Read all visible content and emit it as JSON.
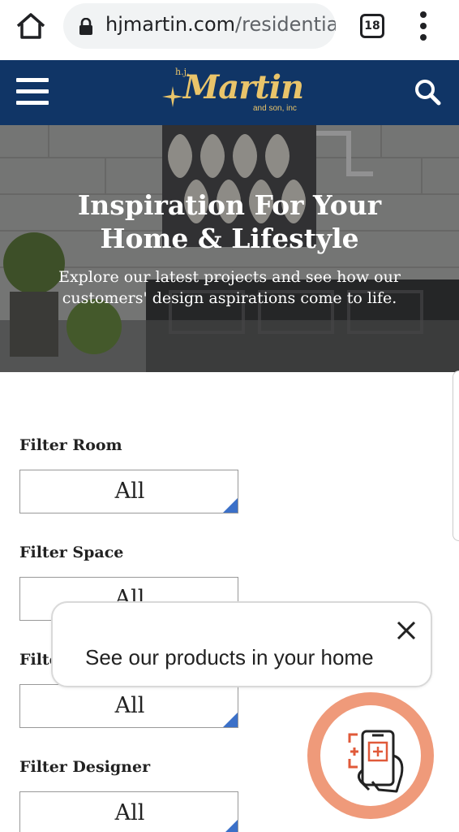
{
  "browser": {
    "url_domain": "hjmartin.com",
    "url_path": "/residentia",
    "tab_count": "18"
  },
  "header": {
    "logo_prefix": "h.j.",
    "logo_name": "Martin",
    "logo_suffix": "and son, inc"
  },
  "hero": {
    "title_line1": "Inspiration For Your",
    "title_line2": "Home & Lifestyle",
    "subtitle_line1": "Explore our latest projects and see how our",
    "subtitle_line2": "customers' design aspirations come to life."
  },
  "filters": [
    {
      "label": "Filter Room",
      "value": "All"
    },
    {
      "label": "Filter Space",
      "value": "All"
    },
    {
      "label": "Filter Style",
      "value": "All"
    },
    {
      "label": "Filter Designer",
      "value": "All"
    }
  ],
  "popup": {
    "text": "See our products in your home"
  },
  "colors": {
    "header_bg": "#103566",
    "logo_gold": "#e9c46a",
    "select_corner": "#3b70c8",
    "ar_ring": "#ef9a7a"
  }
}
